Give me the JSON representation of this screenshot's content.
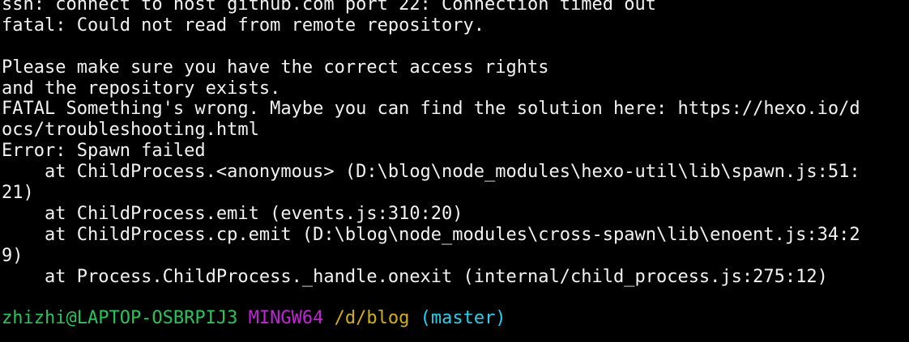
{
  "terminal": {
    "lines": [
      "ssh: connect to host github.com port 22: Connection timed out",
      "fatal: Could not read from remote repository.",
      "",
      "Please make sure you have the correct access rights",
      "and the repository exists.",
      "FATAL Something's wrong. Maybe you can find the solution here: https://hexo.io/d",
      "ocs/troubleshooting.html",
      "Error: Spawn failed",
      "    at ChildProcess.<anonymous> (D:\\blog\\node_modules\\hexo-util\\lib\\spawn.js:51:",
      "21)",
      "    at ChildProcess.emit (events.js:310:20)",
      "    at ChildProcess.cp.emit (D:\\blog\\node_modules\\cross-spawn\\lib\\enoent.js:34:2",
      "9)",
      "    at Process.ChildProcess._handle.onexit (internal/child_process.js:275:12)",
      ""
    ],
    "prompt": {
      "user_host": "zhizhi@LAPTOP-OSBRPIJ3",
      "system": "MINGW64",
      "path": "/d/blog",
      "branch": "(master)"
    },
    "colors": {
      "background": "#000000",
      "text": "#f2f2f2",
      "user_host": "#22c55e",
      "system": "#c026d3",
      "path": "#d4b106",
      "branch": "#22d3ee"
    }
  }
}
